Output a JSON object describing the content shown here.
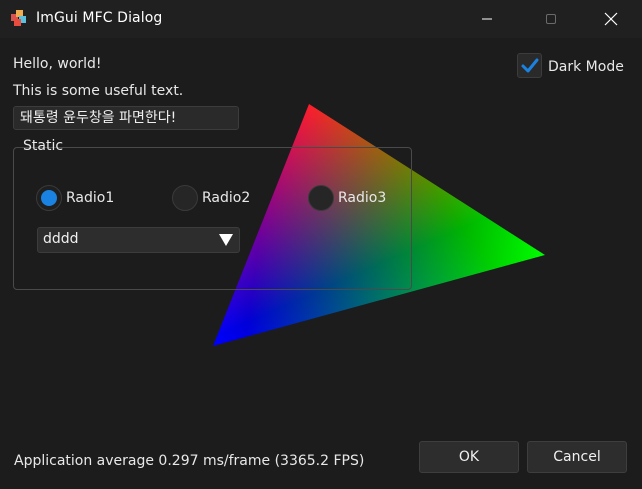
{
  "window": {
    "title": "ImGui MFC Dialog",
    "app_icon": "mfc-app-icon",
    "controls": {
      "minimize_icon": "minimize-icon",
      "maximize_icon": "maximize-icon",
      "close_icon": "close-icon"
    }
  },
  "main": {
    "hello_text": "Hello, world!",
    "useful_text": "This is some useful text.",
    "text_input_value": "돼통령 윤두창을 파면한다!",
    "dark_mode": {
      "label": "Dark Mode",
      "checked": true,
      "accent": "#1a82e0"
    },
    "static_group": {
      "title": "Static",
      "radios": [
        {
          "label": "Radio1",
          "selected": true
        },
        {
          "label": "Radio2",
          "selected": false
        },
        {
          "label": "Radio3",
          "selected": false
        }
      ],
      "combo": {
        "value": "dddd",
        "arrow_icon": "dropdown-triangle-icon"
      }
    },
    "triangle": {
      "description_colors": [
        "#ff0000",
        "#00ff00",
        "#0000ff"
      ]
    },
    "status_text": "Application average 0.297 ms/frame (3365.2 FPS)",
    "buttons": {
      "ok_label": "OK",
      "cancel_label": "Cancel"
    }
  }
}
